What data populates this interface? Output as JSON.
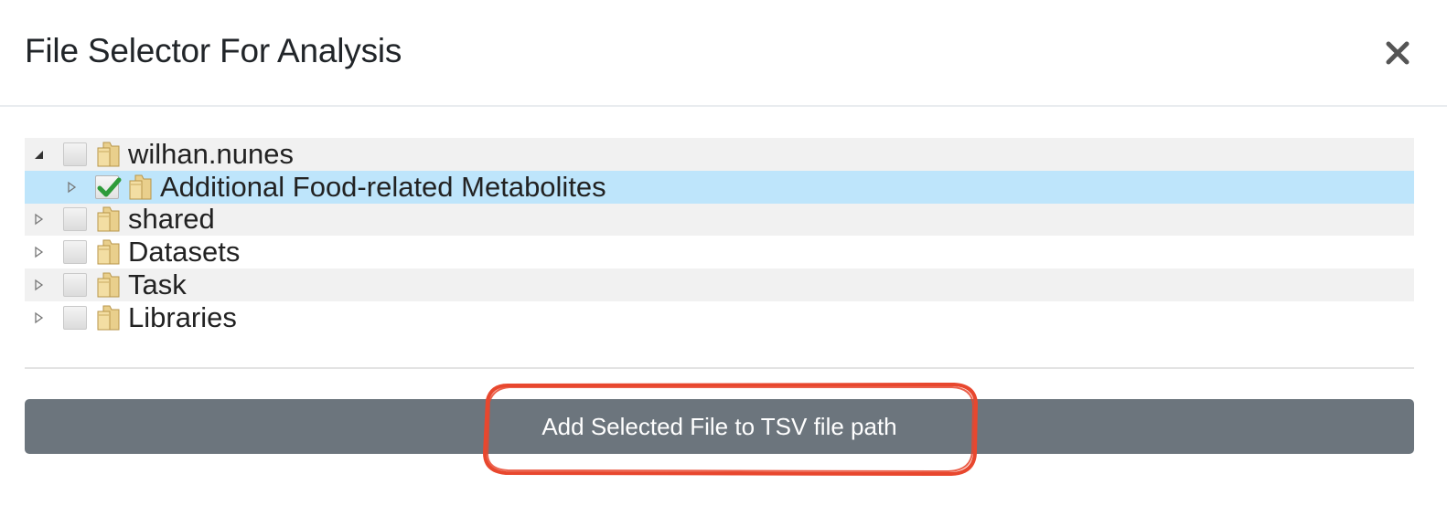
{
  "dialog": {
    "title": "File Selector For Analysis",
    "close_icon": "close-icon"
  },
  "tree": {
    "nodes": [
      {
        "label": "wilhan.nunes",
        "expanded": true,
        "checked": false,
        "level": 0
      },
      {
        "label": "Additional Food-related Metabolites",
        "expanded": false,
        "checked": true,
        "selected": true,
        "level": 1
      },
      {
        "label": "shared",
        "expanded": false,
        "checked": false,
        "level": 0
      },
      {
        "label": "Datasets",
        "expanded": false,
        "checked": false,
        "level": 0
      },
      {
        "label": "Task",
        "expanded": false,
        "checked": false,
        "level": 0
      },
      {
        "label": "Libraries",
        "expanded": false,
        "checked": false,
        "level": 0
      }
    ]
  },
  "actions": {
    "add_label": "Add Selected File to TSV file path"
  },
  "colors": {
    "selected_row": "#bee5fb",
    "alt_row": "#f1f1f1",
    "button": "#6c757d",
    "annotation": "#e8472e"
  }
}
